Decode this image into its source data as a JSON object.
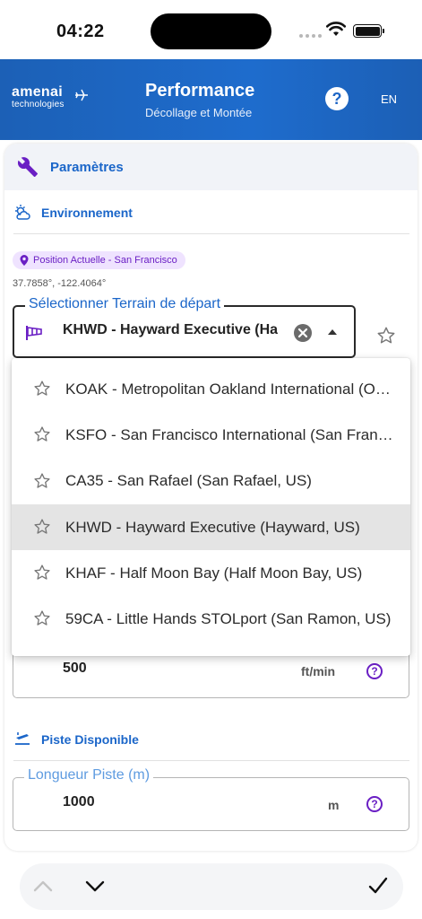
{
  "status_bar": {
    "time": "04:22"
  },
  "header": {
    "logo_line1": "amenai",
    "logo_line2": "technologies",
    "title": "Performance",
    "subtitle": "Décollage et Montée",
    "language": "EN"
  },
  "card": {
    "title": "Paramètres",
    "environment_title": "Environnement",
    "location_chip": "Position Actuelle - San Francisco",
    "coordinates": "37.7858°, -122.4064°",
    "departure_field": {
      "label": "Sélectionner Terrain de départ",
      "value": "KHWD - Hayward Executive (Ha"
    },
    "climb_rate": {
      "value": "500",
      "unit": "ft/min"
    },
    "runway_title": "Piste Disponible",
    "runway_length": {
      "label": "Longueur Piste (m)",
      "value": "1000",
      "unit": "m"
    }
  },
  "dropdown": {
    "options": [
      {
        "label": "KOAK - Metropolitan Oakland International (Oakland, US)",
        "selected": false
      },
      {
        "label": "KSFO - San Francisco International (San Francisco, US)",
        "selected": false
      },
      {
        "label": "CA35 - San Rafael (San Rafael, US)",
        "selected": false
      },
      {
        "label": "KHWD - Hayward Executive (Hayward, US)",
        "selected": true
      },
      {
        "label": "KHAF - Half Moon Bay (Half Moon Bay, US)",
        "selected": false
      },
      {
        "label": "59CA - Little Hands STOLport (San Ramon, US)",
        "selected": false
      }
    ]
  },
  "colors": {
    "header_blue": "#1e66c6",
    "accent_blue": "#1b66c9",
    "accent_purple": "#6a1fc4"
  }
}
